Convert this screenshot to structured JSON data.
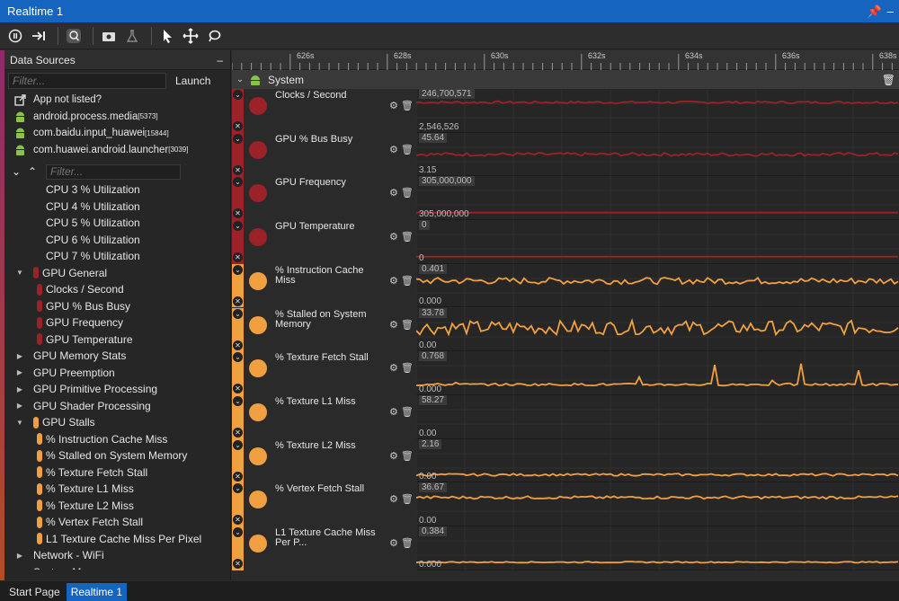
{
  "window": {
    "title": "Realtime 1"
  },
  "colors": {
    "accent": "#1565c0",
    "gpu_general": "#9b2226",
    "gpu_stalls": "#f0a040"
  },
  "toolbar": {
    "icons": [
      "pause-icon",
      "step-forward-icon",
      "zoom-fit-icon",
      "camera-icon",
      "lab-flask-icon",
      "pointer-icon",
      "pan-icon",
      "lasso-icon"
    ]
  },
  "data_sources": {
    "header": "Data Sources",
    "collapse_glyph": "–",
    "filter_placeholder": "Filter...",
    "launch_label": "Launch",
    "apps": [
      {
        "name": "App not listed?",
        "pid": ""
      },
      {
        "name": "android.process.media",
        "pid": "[5373]"
      },
      {
        "name": "com.baidu.input_huawei",
        "pid": "[15844]"
      },
      {
        "name": "com.huawei.android.launcher",
        "pid": "[3039]"
      }
    ],
    "tree_filter_placeholder": "Filter..."
  },
  "tree": [
    {
      "label": "CPU 3 % Utilization",
      "level": 2,
      "arrow": "",
      "pill": ""
    },
    {
      "label": "CPU 4 % Utilization",
      "level": 2,
      "arrow": "",
      "pill": ""
    },
    {
      "label": "CPU 5 % Utilization",
      "level": 2,
      "arrow": "",
      "pill": ""
    },
    {
      "label": "CPU 6 % Utilization",
      "level": 2,
      "arrow": "",
      "pill": ""
    },
    {
      "label": "CPU 7 % Utilization",
      "level": 2,
      "arrow": "",
      "pill": ""
    },
    {
      "label": "GPU General",
      "level": 1,
      "arrow": "▼",
      "pill": "#9b2226"
    },
    {
      "label": "Clocks / Second",
      "level": 2,
      "arrow": "",
      "pill": "#9b2226"
    },
    {
      "label": "GPU % Bus Busy",
      "level": 2,
      "arrow": "",
      "pill": "#9b2226"
    },
    {
      "label": "GPU Frequency",
      "level": 2,
      "arrow": "",
      "pill": "#9b2226"
    },
    {
      "label": "GPU Temperature",
      "level": 2,
      "arrow": "",
      "pill": "#9b2226"
    },
    {
      "label": "GPU Memory Stats",
      "level": 1,
      "arrow": "▶",
      "pill": ""
    },
    {
      "label": "GPU Preemption",
      "level": 1,
      "arrow": "▶",
      "pill": ""
    },
    {
      "label": "GPU Primitive Processing",
      "level": 1,
      "arrow": "▶",
      "pill": ""
    },
    {
      "label": "GPU Shader Processing",
      "level": 1,
      "arrow": "▶",
      "pill": ""
    },
    {
      "label": "GPU Stalls",
      "level": 1,
      "arrow": "▼",
      "pill": "#f0a040"
    },
    {
      "label": "% Instruction Cache Miss",
      "level": 2,
      "arrow": "",
      "pill": "#f0a040"
    },
    {
      "label": "% Stalled on System Memory",
      "level": 2,
      "arrow": "",
      "pill": "#f0a040"
    },
    {
      "label": "% Texture Fetch Stall",
      "level": 2,
      "arrow": "",
      "pill": "#f0a040"
    },
    {
      "label": "% Texture L1 Miss",
      "level": 2,
      "arrow": "",
      "pill": "#f0a040"
    },
    {
      "label": "% Texture L2 Miss",
      "level": 2,
      "arrow": "",
      "pill": "#f0a040"
    },
    {
      "label": "% Vertex Fetch Stall",
      "level": 2,
      "arrow": "",
      "pill": "#f0a040"
    },
    {
      "label": "L1 Texture Cache Miss Per Pixel",
      "level": 2,
      "arrow": "",
      "pill": "#f0a040"
    },
    {
      "label": "Network - WiFi",
      "level": 1,
      "arrow": "▶",
      "pill": ""
    },
    {
      "label": "System Memory",
      "level": 1,
      "arrow": "▼",
      "pill": ""
    }
  ],
  "timeline": {
    "ticks": [
      "626s",
      "628s",
      "630s",
      "632s",
      "634s",
      "636s",
      "638s"
    ],
    "group_label": "System"
  },
  "tracks": [
    {
      "name": "Clocks / Second",
      "color": "#9b2226",
      "max": "246,700,571",
      "min": "2,546,526",
      "shape": "noisy-flat",
      "level": 0.84,
      "amp": 0.04
    },
    {
      "name": "GPU % Bus Busy",
      "color": "#9b2226",
      "max": "45.64",
      "min": "3.15",
      "shape": "noisy-flat",
      "level": 0.55,
      "amp": 0.06
    },
    {
      "name": "GPU Frequency",
      "color": "#9b2226",
      "max": "305,000,000",
      "min": "305,000,000",
      "shape": "flat",
      "level": 0.0,
      "amp": 0.0
    },
    {
      "name": "GPU Temperature",
      "color": "#9b2226",
      "max": "0",
      "min": "0",
      "shape": "flat",
      "level": 0.0,
      "amp": 0.0
    },
    {
      "name": "% Instruction Cache Miss",
      "color": "#f0a040",
      "max": "0.401",
      "min": "0.000",
      "shape": "noisy",
      "level": 0.72,
      "amp": 0.12
    },
    {
      "name": "% Stalled on System Memory",
      "color": "#f0a040",
      "max": "33.78",
      "min": "0.00",
      "shape": "noisy",
      "level": 0.62,
      "amp": 0.25
    },
    {
      "name": "% Texture Fetch Stall",
      "color": "#f0a040",
      "max": "0.768",
      "min": "0.000",
      "shape": "spiky",
      "level": 0.08,
      "amp": 0.9
    },
    {
      "name": "% Texture L1 Miss",
      "color": "#f0a040",
      "max": "58.27",
      "min": "0.00",
      "shape": "none",
      "level": 0,
      "amp": 0
    },
    {
      "name": "% Texture L2 Miss",
      "color": "#f0a040",
      "max": "2.16",
      "min": "0.00",
      "shape": "low",
      "level": 0.04,
      "amp": 0.04
    },
    {
      "name": "% Vertex Fetch Stall",
      "color": "#f0a040",
      "max": "36.67",
      "min": "0.00",
      "shape": "noisy-flat",
      "level": 0.78,
      "amp": 0.05
    },
    {
      "name": "L1 Texture Cache Miss Per P...",
      "color": "#f0a040",
      "max": "0.384",
      "min": "0.000",
      "shape": "low",
      "level": 0.03,
      "amp": 0.02
    }
  ],
  "status_tabs": [
    "Start Page",
    "Realtime 1"
  ]
}
